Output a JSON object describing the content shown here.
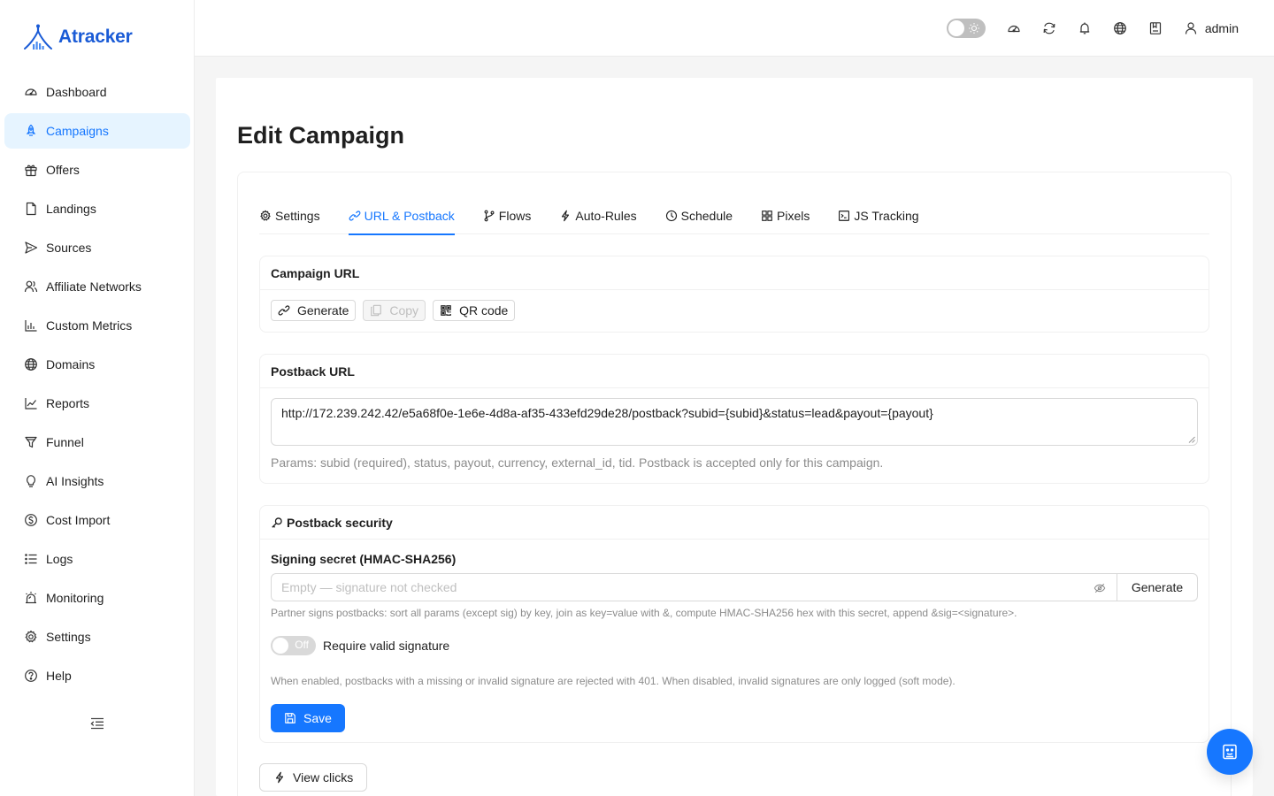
{
  "app": {
    "name": "Atracker",
    "brand_color": "#1a5bd6",
    "accent_color": "#1677ff"
  },
  "sidebar": {
    "items": [
      {
        "label": "Dashboard",
        "icon": "dashboard-icon",
        "active": false
      },
      {
        "label": "Campaigns",
        "icon": "rocket-icon",
        "active": true
      },
      {
        "label": "Offers",
        "icon": "gift-icon",
        "active": false
      },
      {
        "label": "Landings",
        "icon": "file-icon",
        "active": false
      },
      {
        "label": "Sources",
        "icon": "send-icon",
        "active": false
      },
      {
        "label": "Affiliate Networks",
        "icon": "users-icon",
        "active": false
      },
      {
        "label": "Custom Metrics",
        "icon": "bar-chart-icon",
        "active": false
      },
      {
        "label": "Domains",
        "icon": "globe-icon",
        "active": false
      },
      {
        "label": "Reports",
        "icon": "line-chart-icon",
        "active": false
      },
      {
        "label": "Funnel",
        "icon": "funnel-icon",
        "active": false
      },
      {
        "label": "AI Insights",
        "icon": "bulb-icon",
        "active": false
      },
      {
        "label": "Cost Import",
        "icon": "dollar-icon",
        "active": false
      },
      {
        "label": "Logs",
        "icon": "list-icon",
        "active": false
      },
      {
        "label": "Monitoring",
        "icon": "alarm-icon",
        "active": false
      },
      {
        "label": "Settings",
        "icon": "gear-icon",
        "active": false
      },
      {
        "label": "Help",
        "icon": "question-icon",
        "active": false
      }
    ],
    "collapse_icon": "menu-fold-icon"
  },
  "header": {
    "theme_toggle": {
      "checked": false,
      "icon": "sun-icon"
    },
    "icons": [
      "dashboard-icon",
      "sync-icon",
      "bell-icon",
      "globe-icon",
      "book-icon"
    ],
    "user": {
      "name": "admin",
      "icon": "user-icon"
    }
  },
  "page": {
    "title": "Edit Campaign",
    "tabs": [
      {
        "label": "Settings",
        "icon": "gear-icon",
        "active": false
      },
      {
        "label": "URL & Postback",
        "icon": "link-icon",
        "active": true
      },
      {
        "label": "Flows",
        "icon": "branch-icon",
        "active": false
      },
      {
        "label": "Auto-Rules",
        "icon": "thunderbolt-icon",
        "active": false
      },
      {
        "label": "Schedule",
        "icon": "clock-icon",
        "active": false
      },
      {
        "label": "Pixels",
        "icon": "grid-icon",
        "active": false
      },
      {
        "label": "JS Tracking",
        "icon": "code-icon",
        "active": false
      }
    ],
    "campaign_url": {
      "title": "Campaign URL",
      "generate_label": "Generate",
      "copy_label": "Copy",
      "qr_label": "QR code"
    },
    "postback_url": {
      "title": "Postback URL",
      "value": "http://172.239.242.42/e5a68f0e-1e6e-4d8a-af35-433efd29de28/postback?subid={subid}&status=lead&payout={payout}",
      "hint": "Params: subid (required), status, payout, currency, external_id, tid. Postback is accepted only for this campaign."
    },
    "postback_security": {
      "title": "Postback security",
      "secret_label": "Signing secret (HMAC-SHA256)",
      "secret_placeholder": "Empty — signature not checked",
      "generate_label": "Generate",
      "secret_hint": "Partner signs postbacks: sort all params (except sig) by key, join as key=value with &, compute HMAC-SHA256 hex with this secret, append &sig=<signature>.",
      "require_switch": {
        "state_text": "Off",
        "checked": false
      },
      "require_label": "Require valid signature",
      "require_hint": "When enabled, postbacks with a missing or invalid signature are rejected with 401. When disabled, invalid signatures are only logged (soft mode).",
      "save_label": "Save"
    },
    "view_clicks_label": "View clicks"
  },
  "fab": {
    "icon": "robot-icon"
  }
}
